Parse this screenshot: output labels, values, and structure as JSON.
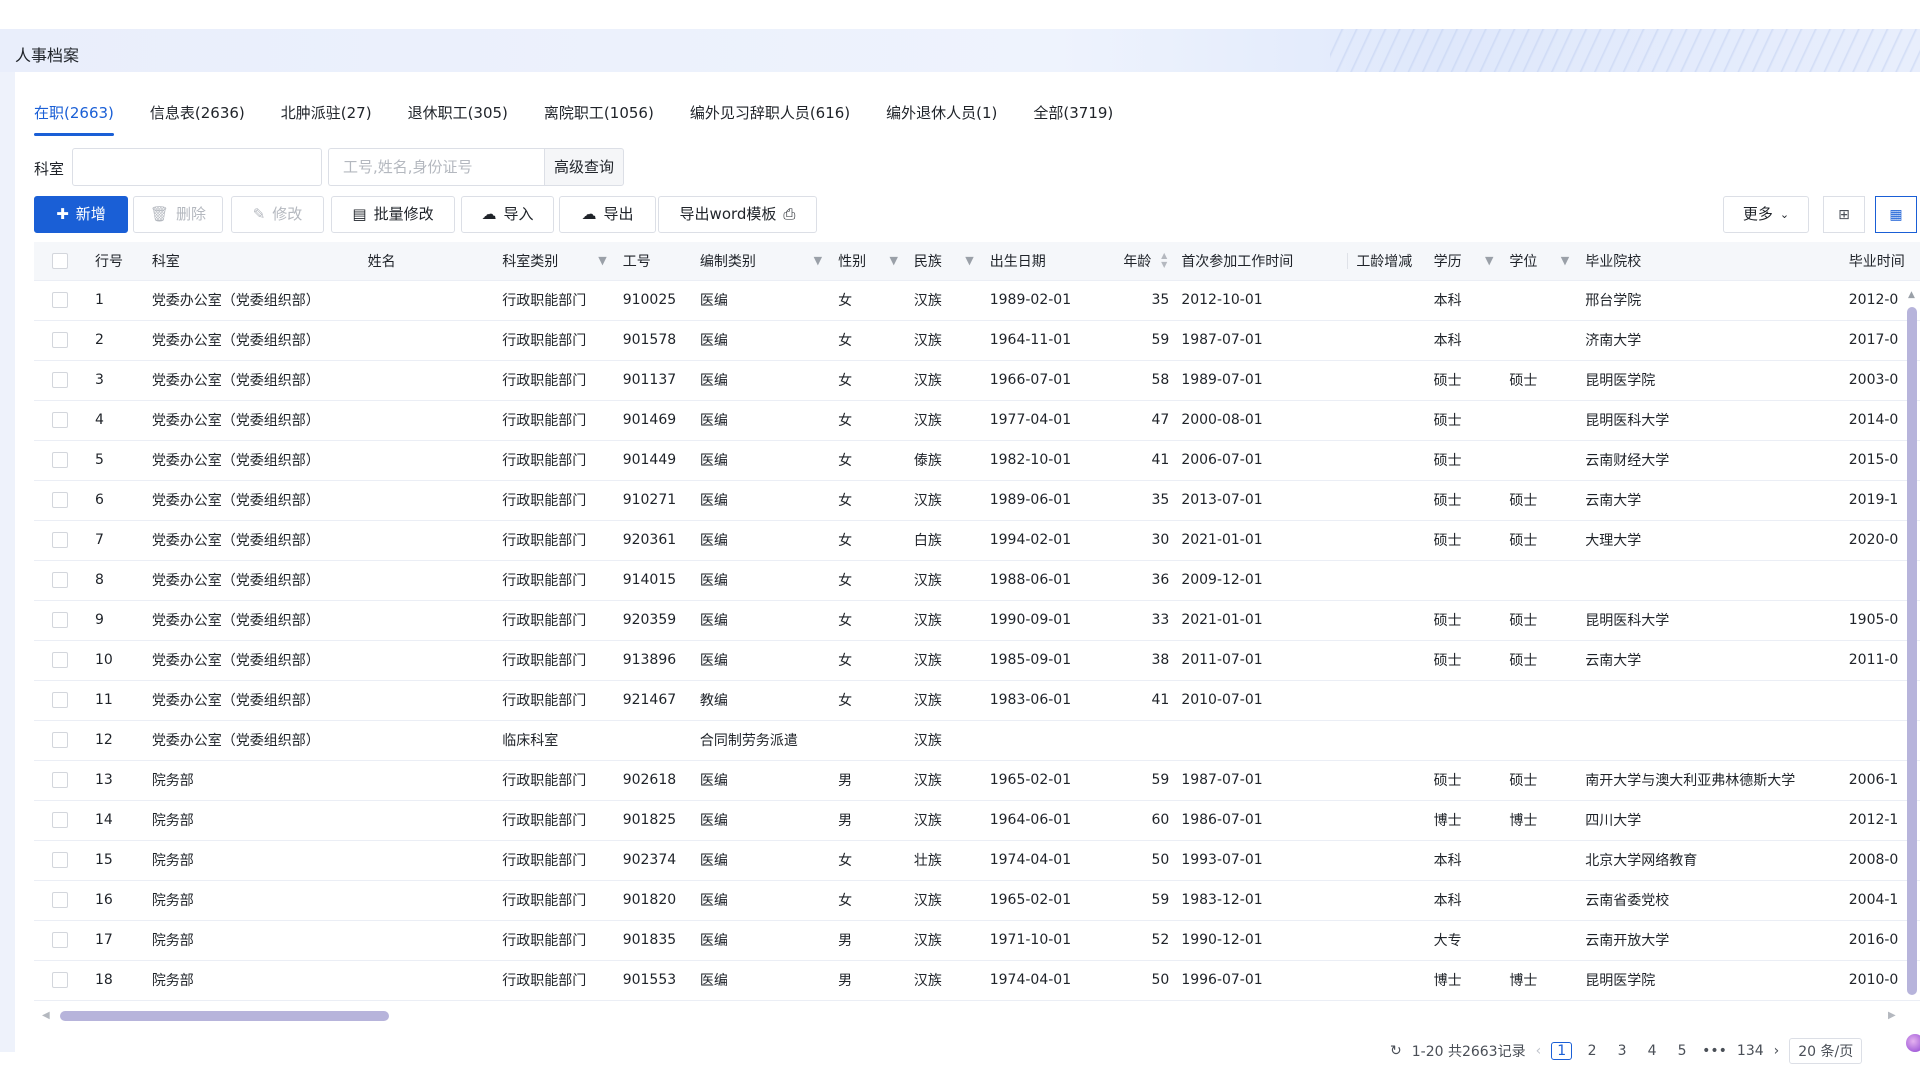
{
  "page_title": "人事档案",
  "tabs": [
    {
      "label": "在职(2663)",
      "active": true
    },
    {
      "label": "信息表(2636)"
    },
    {
      "label": "北肿派驻(27)"
    },
    {
      "label": "退休职工(305)"
    },
    {
      "label": "离院职工(1056)"
    },
    {
      "label": "编外见习辞职人员(616)"
    },
    {
      "label": "编外退休人员(1)"
    },
    {
      "label": "全部(3719)"
    }
  ],
  "filter": {
    "dept_label": "科室",
    "dept_value": "",
    "search_placeholder": "工号,姓名,身份证号",
    "advanced_label": "高级查询"
  },
  "toolbar": {
    "add": "新增",
    "delete": "删除",
    "edit": "修改",
    "batch_edit": "批量修改",
    "import": "导入",
    "export": "导出",
    "export_word": "导出word模板",
    "more": "更多"
  },
  "columns": [
    "行号",
    "科室",
    "姓名",
    "科室类别",
    "工号",
    "编制类别",
    "性别",
    "民族",
    "出生日期",
    "年龄",
    "首次参加工作时间",
    "工龄增减",
    "学历",
    "学位",
    "毕业院校",
    "毕业时间"
  ],
  "rows": [
    [
      "1",
      "党委办公室（党委组织部）",
      "",
      "行政职能部门",
      "910025",
      "医编",
      "女",
      "汉族",
      "1989-02-01",
      "35",
      "2012-10-01",
      "",
      "本科",
      "",
      "邢台学院",
      "2012-0"
    ],
    [
      "2",
      "党委办公室（党委组织部）",
      "",
      "行政职能部门",
      "901578",
      "医编",
      "女",
      "汉族",
      "1964-11-01",
      "59",
      "1987-07-01",
      "",
      "本科",
      "",
      "济南大学",
      "2017-0"
    ],
    [
      "3",
      "党委办公室（党委组织部）",
      "",
      "行政职能部门",
      "901137",
      "医编",
      "女",
      "汉族",
      "1966-07-01",
      "58",
      "1989-07-01",
      "",
      "硕士",
      "硕士",
      "昆明医学院",
      "2003-0"
    ],
    [
      "4",
      "党委办公室（党委组织部）",
      "",
      "行政职能部门",
      "901469",
      "医编",
      "女",
      "汉族",
      "1977-04-01",
      "47",
      "2000-08-01",
      "",
      "硕士",
      "",
      "昆明医科大学",
      "2014-0"
    ],
    [
      "5",
      "党委办公室（党委组织部）",
      "",
      "行政职能部门",
      "901449",
      "医编",
      "女",
      "傣族",
      "1982-10-01",
      "41",
      "2006-07-01",
      "",
      "硕士",
      "",
      "云南财经大学",
      "2015-0"
    ],
    [
      "6",
      "党委办公室（党委组织部）",
      "",
      "行政职能部门",
      "910271",
      "医编",
      "女",
      "汉族",
      "1989-06-01",
      "35",
      "2013-07-01",
      "",
      "硕士",
      "硕士",
      "云南大学",
      "2019-1"
    ],
    [
      "7",
      "党委办公室（党委组织部）",
      "",
      "行政职能部门",
      "920361",
      "医编",
      "女",
      "白族",
      "1994-02-01",
      "30",
      "2021-01-01",
      "",
      "硕士",
      "硕士",
      "大理大学",
      "2020-0"
    ],
    [
      "8",
      "党委办公室（党委组织部）",
      "",
      "行政职能部门",
      "914015",
      "医编",
      "女",
      "汉族",
      "1988-06-01",
      "36",
      "2009-12-01",
      "",
      "",
      "",
      "",
      ""
    ],
    [
      "9",
      "党委办公室（党委组织部）",
      "",
      "行政职能部门",
      "920359",
      "医编",
      "女",
      "汉族",
      "1990-09-01",
      "33",
      "2021-01-01",
      "",
      "硕士",
      "硕士",
      "昆明医科大学",
      "1905-0"
    ],
    [
      "10",
      "党委办公室（党委组织部）",
      "",
      "行政职能部门",
      "913896",
      "医编",
      "女",
      "汉族",
      "1985-09-01",
      "38",
      "2011-07-01",
      "",
      "硕士",
      "硕士",
      "云南大学",
      "2011-0"
    ],
    [
      "11",
      "党委办公室（党委组织部）",
      "",
      "行政职能部门",
      "921467",
      "教编",
      "女",
      "汉族",
      "1983-06-01",
      "41",
      "2010-07-01",
      "",
      "",
      "",
      "",
      ""
    ],
    [
      "12",
      "党委办公室（党委组织部）",
      "",
      "临床科室",
      "",
      "合同制劳务派遣",
      "",
      "汉族",
      "",
      "",
      "",
      "",
      "",
      "",
      "",
      ""
    ],
    [
      "13",
      "院务部",
      "",
      "行政职能部门",
      "902618",
      "医编",
      "男",
      "汉族",
      "1965-02-01",
      "59",
      "1987-07-01",
      "",
      "硕士",
      "硕士",
      "南开大学与澳大利亚弗林德斯大学",
      "2006-1"
    ],
    [
      "14",
      "院务部",
      "",
      "行政职能部门",
      "901825",
      "医编",
      "男",
      "汉族",
      "1964-06-01",
      "60",
      "1986-07-01",
      "",
      "博士",
      "博士",
      "四川大学",
      "2012-1"
    ],
    [
      "15",
      "院务部",
      "",
      "行政职能部门",
      "902374",
      "医编",
      "女",
      "壮族",
      "1974-04-01",
      "50",
      "1993-07-01",
      "",
      "本科",
      "",
      "北京大学网络教育",
      "2008-0"
    ],
    [
      "16",
      "院务部",
      "",
      "行政职能部门",
      "901820",
      "医编",
      "女",
      "汉族",
      "1965-02-01",
      "59",
      "1983-12-01",
      "",
      "本科",
      "",
      "云南省委党校",
      "2004-1"
    ],
    [
      "17",
      "院务部",
      "",
      "行政职能部门",
      "901835",
      "医编",
      "男",
      "汉族",
      "1971-10-01",
      "52",
      "1990-12-01",
      "",
      "大专",
      "",
      "云南开放大学",
      "2016-0"
    ],
    [
      "18",
      "院务部",
      "",
      "行政职能部门",
      "901553",
      "医编",
      "男",
      "汉族",
      "1974-04-01",
      "50",
      "1996-07-01",
      "",
      "博士",
      "博士",
      "昆明医学院",
      "2010-0"
    ]
  ],
  "pagination": {
    "summary": "1-20 共2663记录",
    "pages": [
      "1",
      "2",
      "3",
      "4",
      "5",
      "•••",
      "134"
    ],
    "current": "1",
    "page_size": "20 条/页"
  },
  "colors": {
    "primary": "#1a5fd6",
    "scrollbar": "#b7b4db"
  }
}
